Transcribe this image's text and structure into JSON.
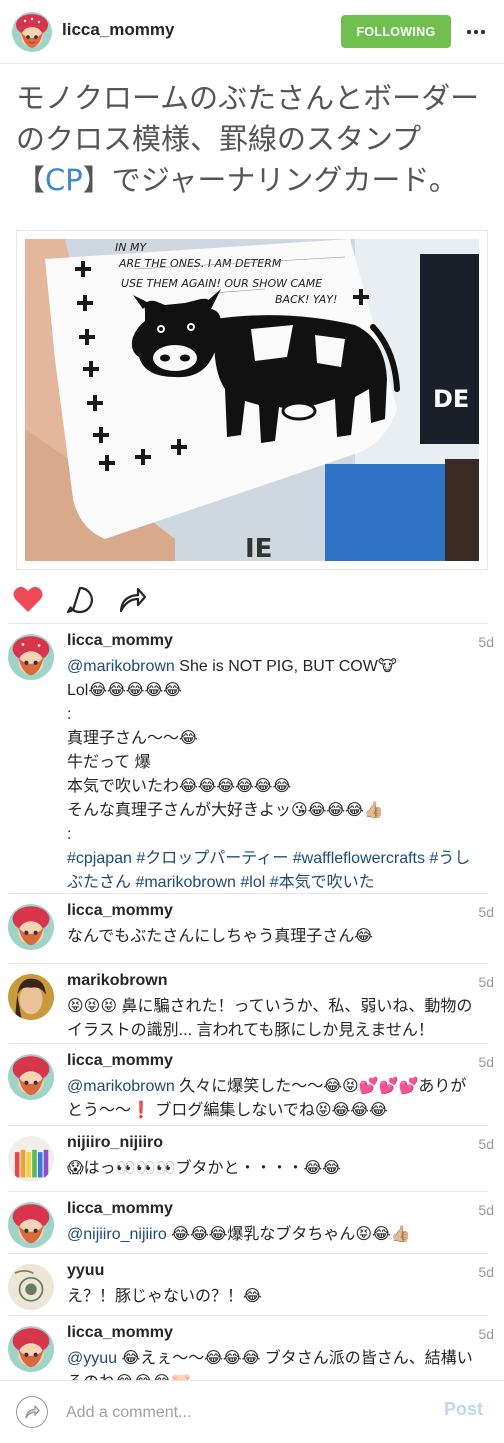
{
  "header": {
    "username": "licca_mommy",
    "follow_label": "FOLLOWING",
    "more_icon": "more-icon"
  },
  "post": {
    "title_before": "モノクロームのぶたさんとボーダーのクロス模様、罫線のスタンプ【",
    "title_cp": "CP",
    "title_after": "】でジャーナリングカード。",
    "photo_text_1": "IN MY",
    "photo_text_2": "ARE THE ONES. I AM DETERM",
    "photo_text_3": "USE THEM AGAIN! OUR SHOW CAME",
    "photo_text_4": "BACK! YAY!",
    "photo_sign": "DE",
    "photo_sign_2": "IE"
  },
  "actions": {
    "like_icon": "heart-icon",
    "comment_icon": "comment-icon",
    "share_icon": "share-icon",
    "like_color": "#ed4956"
  },
  "comments": [
    {
      "user": "licca_mommy",
      "time": "5d",
      "mention": "@marikobrown",
      "lines": [
        " She is NOT PIG, BUT COW🐮",
        "Lol😂😂😂😂😂",
        ":",
        "真理子さん〜〜😂",
        "牛だって 爆",
        "本気で吹いたわ😂😂😂😂😂😂",
        "そんな真理子さんが大好きよッ😘😂😂😂👍🏼",
        ":"
      ],
      "tags": "#cpjapan #クロップパーティー #waffleflowercrafts #うしぶたさん #marikobrown #lol #本気で吹いた"
    },
    {
      "user": "licca_mommy",
      "time": "5d",
      "text": "なんでもぶたさんにしちゃう真理子さん😂"
    },
    {
      "user": "marikobrown",
      "time": "5d",
      "text": "😝😝😝 鼻に騙された！っていうか、私、弱いね、動物のイラストの識別... 言われても豚にしか見えません！"
    },
    {
      "user": "licca_mommy",
      "time": "5d",
      "mention": "@marikobrown",
      "text": " 久々に爆笑した〜〜😂😝💕💕💕ありがとう〜〜❗️ ブログ編集しないでね😝😂😂😂"
    },
    {
      "user": "nijiiro_nijiiro",
      "time": "5d",
      "text": "😱はっ👀👀👀ブタかと・・・・😂😂"
    },
    {
      "user": "licca_mommy",
      "time": "5d",
      "mention": "@nijiiro_nijiiro",
      "text": " 😂😂😂爆乳なブタちゃん😝😂👍🏼"
    },
    {
      "user": "yyuu",
      "time": "5d",
      "text": "え？！豚じゃないの？！😂"
    },
    {
      "user": "licca_mommy",
      "time": "5d",
      "mention": "@yyuu",
      "text": " 😂えぇ〜〜😂😂😂 ブタさん派の皆さん、結構いるのね😂😂😂🐷"
    }
  ],
  "footer": {
    "placeholder": "Add a comment...",
    "post_label": "Post",
    "share_icon": "share-circle-icon"
  },
  "colors": {
    "follow_green": "#70c050",
    "mention_blue": "#1e4b7a",
    "post_disabled": "#b8daf2",
    "title_gray": "#555555"
  }
}
